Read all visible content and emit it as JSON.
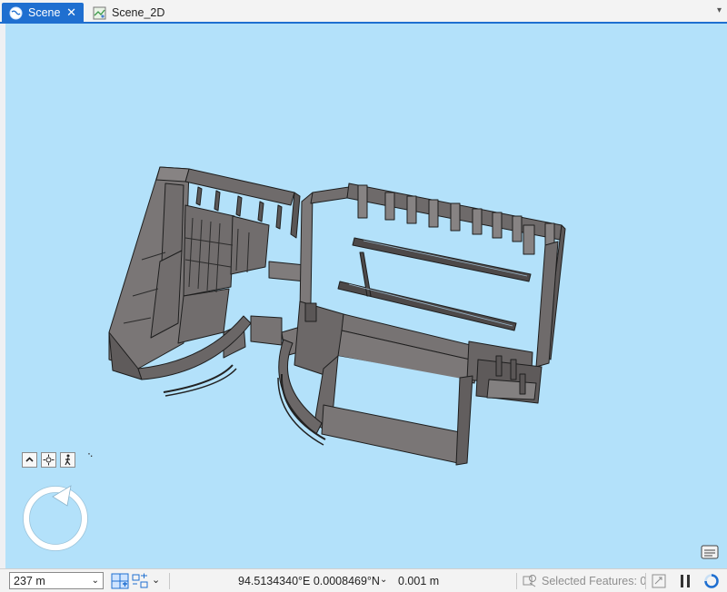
{
  "tabs": [
    {
      "label": "Scene",
      "active": true,
      "icon": "globe-icon"
    },
    {
      "label": "Scene_2D",
      "active": false,
      "icon": "map-icon"
    }
  ],
  "map": {
    "background_color": "#b3e1fa",
    "content": "3D building wall model"
  },
  "nav": {
    "buttons": [
      "expand-up-icon",
      "full-extent-icon",
      "walk-icon"
    ]
  },
  "status": {
    "scale": "237 m",
    "coordinates": "94.5134340°E 0.0008469°N",
    "elevation": "0.001 m",
    "selected_features": "Selected Features: 0"
  },
  "colors": {
    "accent": "#1f6fd0",
    "wall_fill": "#6e6a6a",
    "wall_edge": "#222222"
  }
}
